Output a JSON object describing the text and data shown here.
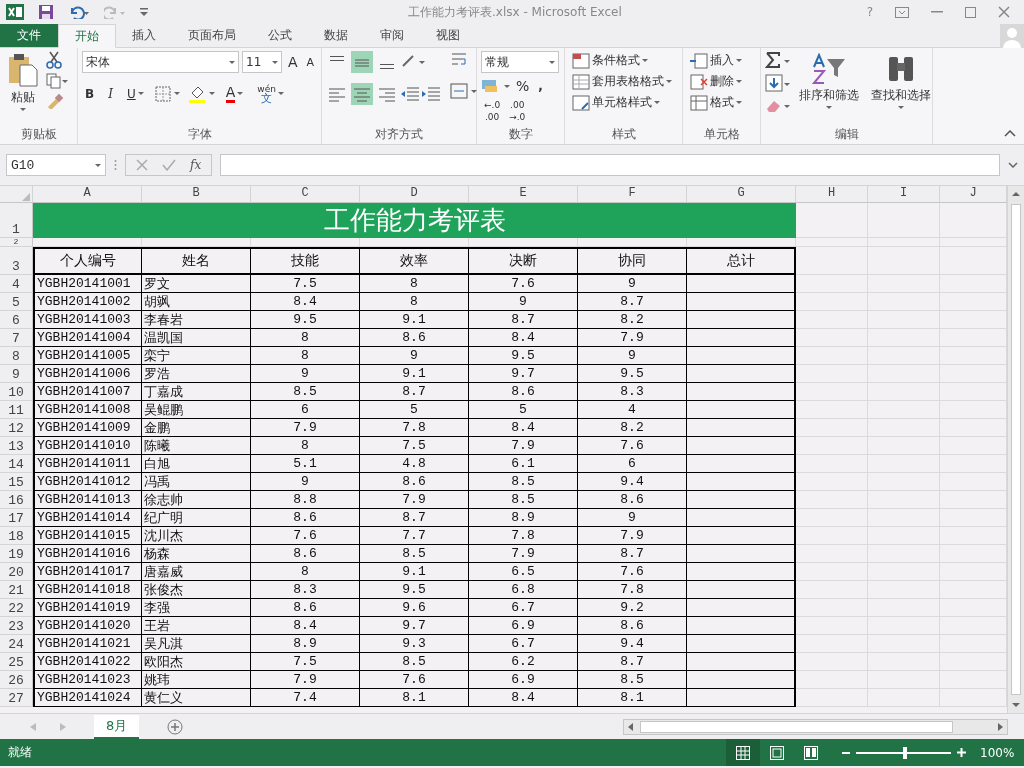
{
  "window": {
    "title": "工作能力考评表.xlsx - Microsoft Excel",
    "help": "?"
  },
  "tabs": [
    {
      "label": "文件",
      "kind": "file",
      "selected": false
    },
    {
      "label": "开始",
      "kind": "tab",
      "selected": true
    },
    {
      "label": "插入",
      "kind": "tab",
      "selected": false
    },
    {
      "label": "页面布局",
      "kind": "tab",
      "selected": false
    },
    {
      "label": "公式",
      "kind": "tab",
      "selected": false
    },
    {
      "label": "数据",
      "kind": "tab",
      "selected": false
    },
    {
      "label": "审阅",
      "kind": "tab",
      "selected": false
    },
    {
      "label": "视图",
      "kind": "tab",
      "selected": false
    }
  ],
  "ribbon": {
    "clipboard": {
      "paste": "粘贴",
      "label": "剪贴板"
    },
    "font": {
      "name": "宋体",
      "size": "11",
      "grow": "A",
      "shrink": "A",
      "bold": "B",
      "italic": "I",
      "underline": "U",
      "font_color_letter": "A",
      "phonetic_top": "wén",
      "phonetic_bottom": "文",
      "label": "字体"
    },
    "alignment": {
      "buttons": [
        {
          "kind": "top",
          "selected": false
        },
        {
          "kind": "middle",
          "selected": true
        },
        {
          "kind": "bottom",
          "selected": false
        },
        {
          "kind": "left",
          "selected": false
        },
        {
          "kind": "center",
          "selected": true
        },
        {
          "kind": "right",
          "selected": false
        }
      ],
      "label": "对齐方式"
    },
    "number": {
      "format": "常规",
      "percent": "%",
      "comma": ",",
      "decimals": [
        {
          "top": "←.0",
          "bottom": ".00"
        },
        {
          "top": ".00",
          "bottom": "→.0"
        }
      ],
      "label": "数字"
    },
    "styles": {
      "items": [
        "条件格式",
        "套用表格格式",
        "单元格样式"
      ],
      "label": "样式"
    },
    "cells": {
      "items": [
        "插入",
        "删除",
        "格式"
      ],
      "label": "单元格"
    },
    "editing": {
      "sort": "排序和筛选",
      "find": "查找和选择",
      "label": "编辑"
    }
  },
  "formula_bar": {
    "name_box": "G10",
    "fx": "fx"
  },
  "sheet": {
    "columns": [
      "A",
      "B",
      "C",
      "D",
      "E",
      "F",
      "G",
      "H",
      "I",
      "J"
    ],
    "title_row": {
      "number": "1",
      "text": "工作能力考评表"
    },
    "spacer_row": {
      "number": "2"
    },
    "header_row": {
      "number": "3",
      "cells": [
        "个人编号",
        "姓名",
        "技能",
        "效率",
        "决断",
        "协同",
        "总计"
      ]
    },
    "rows": [
      {
        "number": "4",
        "cells": [
          "YGBH20141001",
          "罗文",
          "7.5",
          "8",
          "7.6",
          "9"
        ]
      },
      {
        "number": "5",
        "cells": [
          "YGBH20141002",
          "胡飒",
          "8.4",
          "8",
          "9",
          "8.7"
        ]
      },
      {
        "number": "6",
        "cells": [
          "YGBH20141003",
          "李春岩",
          "9.5",
          "9.1",
          "8.7",
          "8.2"
        ]
      },
      {
        "number": "7",
        "cells": [
          "YGBH20141004",
          "温凯国",
          "8",
          "8.6",
          "8.4",
          "7.9"
        ]
      },
      {
        "number": "8",
        "cells": [
          "YGBH20141005",
          "栾宁",
          "8",
          "9",
          "9.5",
          "9"
        ]
      },
      {
        "number": "9",
        "cells": [
          "YGBH20141006",
          "罗浩",
          "9",
          "9.1",
          "9.7",
          "9.5"
        ]
      },
      {
        "number": "10",
        "cells": [
          "YGBH20141007",
          "丁嘉成",
          "8.5",
          "8.7",
          "8.6",
          "8.3"
        ]
      },
      {
        "number": "11",
        "cells": [
          "YGBH20141008",
          "吴鲲鹏",
          "6",
          "5",
          "5",
          "4"
        ]
      },
      {
        "number": "12",
        "cells": [
          "YGBH20141009",
          "金鹏",
          "7.9",
          "7.8",
          "8.4",
          "8.2"
        ]
      },
      {
        "number": "13",
        "cells": [
          "YGBH20141010",
          "陈曦",
          "8",
          "7.5",
          "7.9",
          "7.6"
        ]
      },
      {
        "number": "14",
        "cells": [
          "YGBH20141011",
          "白旭",
          "5.1",
          "4.8",
          "6.1",
          "6"
        ]
      },
      {
        "number": "15",
        "cells": [
          "YGBH20141012",
          "冯禹",
          "9",
          "8.6",
          "8.5",
          "9.4"
        ]
      },
      {
        "number": "16",
        "cells": [
          "YGBH20141013",
          "徐志帅",
          "8.8",
          "7.9",
          "8.5",
          "8.6"
        ]
      },
      {
        "number": "17",
        "cells": [
          "YGBH20141014",
          "纪广明",
          "8.6",
          "8.7",
          "8.9",
          "9"
        ]
      },
      {
        "number": "18",
        "cells": [
          "YGBH20141015",
          "沈川杰",
          "7.6",
          "7.7",
          "7.8",
          "7.9"
        ]
      },
      {
        "number": "19",
        "cells": [
          "YGBH20141016",
          "杨森",
          "8.6",
          "8.5",
          "7.9",
          "8.7"
        ]
      },
      {
        "number": "20",
        "cells": [
          "YGBH20141017",
          "唐嘉威",
          "8",
          "9.1",
          "6.5",
          "7.6"
        ]
      },
      {
        "number": "21",
        "cells": [
          "YGBH20141018",
          "张俊杰",
          "8.3",
          "9.5",
          "6.8",
          "7.8"
        ]
      },
      {
        "number": "22",
        "cells": [
          "YGBH20141019",
          "李强",
          "8.6",
          "9.6",
          "6.7",
          "9.2"
        ]
      },
      {
        "number": "23",
        "cells": [
          "YGBH20141020",
          "王岩",
          "8.4",
          "9.7",
          "6.9",
          "8.6"
        ]
      },
      {
        "number": "24",
        "cells": [
          "YGBH20141021",
          "吴凡淇",
          "8.9",
          "9.3",
          "6.7",
          "9.4"
        ]
      },
      {
        "number": "25",
        "cells": [
          "YGBH20141022",
          "欧阳杰",
          "7.5",
          "8.5",
          "6.2",
          "8.7"
        ]
      },
      {
        "number": "26",
        "cells": [
          "YGBH20141023",
          "姚玮",
          "7.9",
          "7.6",
          "6.9",
          "8.5"
        ]
      },
      {
        "number": "27",
        "cells": [
          "YGBH20141024",
          "黄仁义",
          "7.4",
          "8.1",
          "8.4",
          "8.1"
        ]
      }
    ]
  },
  "sheet_tabs": [
    {
      "label": "8月",
      "selected": true
    }
  ],
  "status_bar": {
    "text": "就绪",
    "zoom": "100%",
    "zoom_slider": {
      "level": 0.52
    }
  }
}
